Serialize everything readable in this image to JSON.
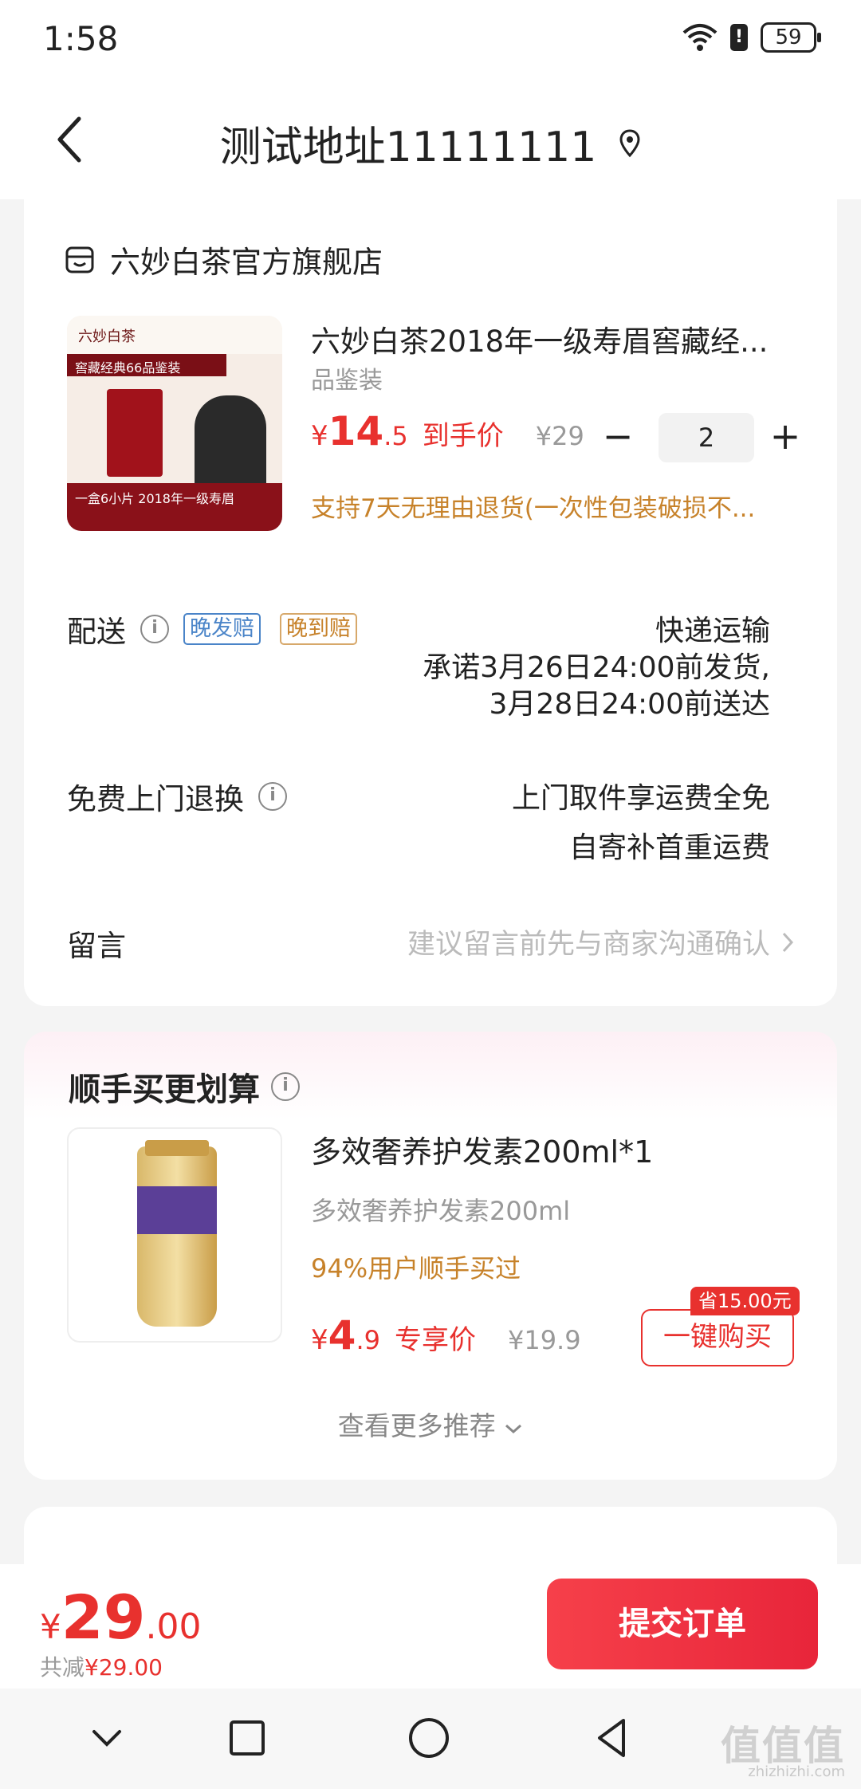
{
  "status": {
    "time": "1:58",
    "battery": "59"
  },
  "nav": {
    "title": "测试地址11111111"
  },
  "shop": {
    "name": "六妙白茶官方旗舰店"
  },
  "product": {
    "image_texts": {
      "top": "六妙白茶",
      "banner": "窖藏经典66品鉴装",
      "bottom": "一盒6小片 2018年一级寿眉"
    },
    "title": "六妙白茶2018年一级寿眉窖藏经...",
    "spec": "品鉴装",
    "price_symbol": "¥",
    "price_int": "14",
    "price_dec": ".5",
    "price_tag": "到手价",
    "price_original": "¥29",
    "quantity": "2",
    "minus": "−",
    "plus": "+",
    "return_note": "支持7天无理由退货(一次性包装破损不..."
  },
  "delivery": {
    "label": "配送",
    "badge_late_ship": "晚发赔",
    "badge_late_arrive": "晚到赔",
    "method": "快递运输",
    "promise_line1": "承诺3月26日24:00前发货,",
    "promise_line2": "3月28日24:00前送达"
  },
  "exchange": {
    "label": "免费上门退换",
    "line1": "上门取件享运费全免",
    "line2": "自寄补首重运费"
  },
  "message": {
    "label": "留言",
    "placeholder": "建议留言前先与商家沟通确认"
  },
  "recommend": {
    "title": "顺手买更划算",
    "name": "多效奢养护发素200ml*1",
    "sub": "多效奢养护发素200ml",
    "stat": "94%用户顺手买过",
    "price_symbol": "¥",
    "price_int": "4",
    "price_dec": ".9",
    "price_tag": "专享价",
    "price_original": "¥19.9",
    "save_badge": "省15.00元",
    "buy_label": "一键购买",
    "more": "查看更多推荐"
  },
  "footer": {
    "total_symbol": "¥",
    "total_int": "29",
    "total_dec": ".00",
    "discount_label": "共减",
    "discount_value": "¥29.00",
    "submit": "提交订单"
  },
  "watermark": {
    "text": "值值值",
    "url": "zhizhizhi.com"
  }
}
